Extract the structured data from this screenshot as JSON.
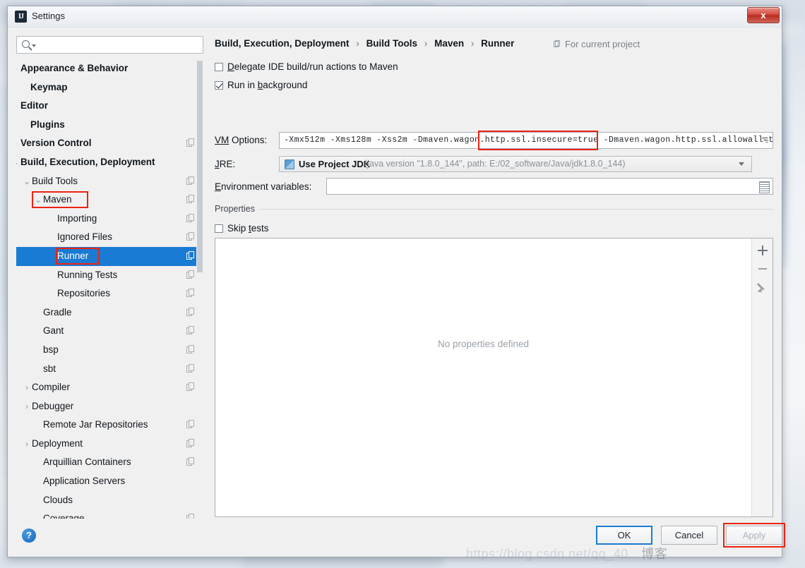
{
  "window": {
    "title": "Settings",
    "app_icon": "IJ",
    "close_label": "x"
  },
  "search": {
    "value": "",
    "placeholder": ""
  },
  "sidebar": {
    "items": [
      {
        "label": "Appearance & Behavior",
        "arrow": "›",
        "indent": 6,
        "bold": true,
        "copy": false,
        "selected": false
      },
      {
        "label": "Keymap",
        "arrow": "",
        "indent": 20,
        "bold": true,
        "copy": false,
        "selected": false
      },
      {
        "label": "Editor",
        "arrow": "›",
        "indent": 6,
        "bold": true,
        "copy": false,
        "selected": false
      },
      {
        "label": "Plugins",
        "arrow": "",
        "indent": 20,
        "bold": true,
        "copy": false,
        "selected": false
      },
      {
        "label": "Version Control",
        "arrow": "›",
        "indent": 6,
        "bold": true,
        "copy": true,
        "selected": false
      },
      {
        "label": "Build, Execution, Deployment",
        "arrow": "⌄",
        "indent": 6,
        "bold": true,
        "copy": false,
        "selected": false
      },
      {
        "label": "Build Tools",
        "arrow": "⌄",
        "indent": 22,
        "bold": false,
        "copy": true,
        "selected": false
      },
      {
        "label": "Maven",
        "arrow": "⌄",
        "indent": 38,
        "bold": false,
        "copy": true,
        "selected": false
      },
      {
        "label": "Importing",
        "arrow": "",
        "indent": 58,
        "bold": false,
        "copy": true,
        "selected": false
      },
      {
        "label": "Ignored Files",
        "arrow": "",
        "indent": 58,
        "bold": false,
        "copy": true,
        "selected": false
      },
      {
        "label": "Runner",
        "arrow": "",
        "indent": 58,
        "bold": false,
        "copy": true,
        "selected": true
      },
      {
        "label": "Running Tests",
        "arrow": "",
        "indent": 58,
        "bold": false,
        "copy": true,
        "selected": false
      },
      {
        "label": "Repositories",
        "arrow": "",
        "indent": 58,
        "bold": false,
        "copy": true,
        "selected": false
      },
      {
        "label": "Gradle",
        "arrow": "",
        "indent": 38,
        "bold": false,
        "copy": true,
        "selected": false
      },
      {
        "label": "Gant",
        "arrow": "",
        "indent": 38,
        "bold": false,
        "copy": true,
        "selected": false
      },
      {
        "label": "bsp",
        "arrow": "",
        "indent": 38,
        "bold": false,
        "copy": true,
        "selected": false
      },
      {
        "label": "sbt",
        "arrow": "",
        "indent": 38,
        "bold": false,
        "copy": true,
        "selected": false
      },
      {
        "label": "Compiler",
        "arrow": "›",
        "indent": 22,
        "bold": false,
        "copy": true,
        "selected": false
      },
      {
        "label": "Debugger",
        "arrow": "›",
        "indent": 22,
        "bold": false,
        "copy": false,
        "selected": false
      },
      {
        "label": "Remote Jar Repositories",
        "arrow": "",
        "indent": 38,
        "bold": false,
        "copy": true,
        "selected": false
      },
      {
        "label": "Deployment",
        "arrow": "›",
        "indent": 22,
        "bold": false,
        "copy": true,
        "selected": false
      },
      {
        "label": "Arquillian Containers",
        "arrow": "",
        "indent": 38,
        "bold": false,
        "copy": true,
        "selected": false
      },
      {
        "label": "Application Servers",
        "arrow": "",
        "indent": 38,
        "bold": false,
        "copy": false,
        "selected": false
      },
      {
        "label": "Clouds",
        "arrow": "",
        "indent": 38,
        "bold": false,
        "copy": false,
        "selected": false
      },
      {
        "label": "Coverage",
        "arrow": "",
        "indent": 38,
        "bold": false,
        "copy": true,
        "selected": false
      }
    ]
  },
  "breadcrumb": {
    "part1": "Build, Execution, Deployment",
    "part2": "Build Tools",
    "part3": "Maven",
    "part4": "Runner",
    "separator": "›",
    "scope_label": "For current project"
  },
  "form": {
    "delegate": {
      "label_pre": "D",
      "label_post": "elegate IDE build/run actions to Maven",
      "checked": false
    },
    "runbg": {
      "label_pre": "Run in ",
      "label_mid": "b",
      "label_post": "ackground",
      "checked": true
    },
    "vm_options": {
      "label_pre": "VM",
      "label_post": " Options:",
      "value": "-Xmx512m -Xms128m -Xss2m -Dmaven.wagon.http.ssl.insecure=true -Dmaven.wagon.http.ssl.allowall=true -Dmave",
      "highlight_value": "-Xmx512m -Xms128m -Xss2m",
      "expand_icon": "⤡"
    },
    "jre": {
      "label_pre": "J",
      "label_post": "RE:",
      "selected_name": "Use Project JDK",
      "selected_desc": "(java version \"1.8.0_144\", path: E:/02_software/Java/jdk1.8.0_144)"
    },
    "env_vars": {
      "label_pre": "E",
      "label_post": "nvironment variables:",
      "value": ""
    },
    "properties_group": "Properties",
    "skip_tests": {
      "label_pre": "Skip ",
      "label_mid": "t",
      "label_post": "ests",
      "checked": false
    },
    "properties_empty": "No properties defined",
    "properties_toolbar": [
      {
        "name": "add-property-button",
        "glyph": "+"
      },
      {
        "name": "remove-property-button",
        "glyph": "−"
      },
      {
        "name": "edit-property-button",
        "glyph": "✎"
      }
    ]
  },
  "footer": {
    "help": "?",
    "ok": "OK",
    "cancel": "Cancel",
    "apply": "Apply"
  },
  "watermark": {
    "text": "https://blog.csdn.net/qq_40…",
    "suffix": "博客"
  },
  "colors": {
    "selection_blue": "#1a7bd4",
    "annotation_red": "#ee2211",
    "close_red": "#b72d22",
    "help_blue": "#1565c0",
    "muted_text": "#8a9199"
  }
}
